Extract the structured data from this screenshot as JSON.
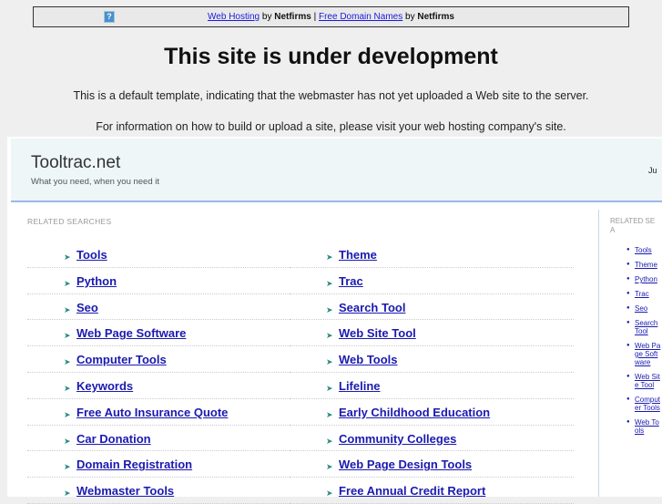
{
  "topbar": {
    "link1": "Web Hosting",
    "by1": "by",
    "brand1": "Netfirms",
    "sep": "|",
    "link2": "Free Domain Names",
    "by2": "by",
    "brand2": "Netfirms",
    "icon": "help-icon"
  },
  "title": "This site is under development",
  "para1": "This is a default template, indicating that the webmaster has not yet uploaded a Web site to the server.",
  "para2": "For information on how to build or upload a site, please visit your web hosting company's site.",
  "site": {
    "name": "Tooltrac.net",
    "tagline": "What you need, when you need it",
    "right_text": "Ju"
  },
  "related_label": "RELATED SEARCHES",
  "side_label": "RELATED SEA",
  "left_items": [
    "Tools",
    "Python",
    "Seo",
    "Web Page Software",
    "Computer Tools",
    "Keywords",
    "Free Auto Insurance Quote",
    "Car Donation",
    "Domain Registration",
    "Webmaster Tools"
  ],
  "right_items": [
    "Theme",
    "Trac",
    "Search Tool",
    "Web Site Tool",
    "Web Tools",
    "Lifeline",
    "Early Childhood Education",
    "Community Colleges",
    "Web Page Design Tools",
    "Free Annual Credit Report"
  ],
  "side_items": [
    "Tools",
    "Theme",
    "Python",
    "Trac",
    "Seo",
    "Search Tool",
    "Web Page Software",
    "Web Site Tool",
    "Computer Tools",
    "Web Tools"
  ]
}
